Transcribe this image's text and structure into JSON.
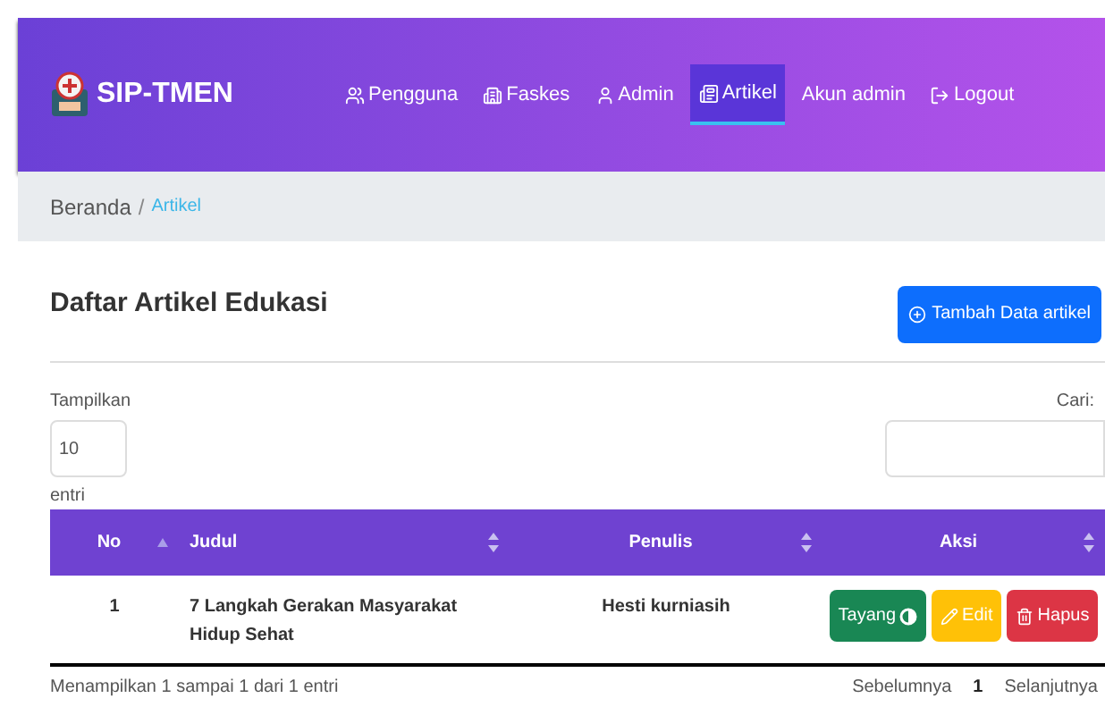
{
  "brand": {
    "name": "SIP-TMEN"
  },
  "nav": [
    {
      "label": "Pengguna",
      "selected": false
    },
    {
      "label": "Faskes",
      "selected": false
    },
    {
      "label": "Admin",
      "selected": false
    },
    {
      "label": "Artikel",
      "selected": true
    },
    {
      "label": "Akun admin",
      "selected": false
    },
    {
      "label": "Logout",
      "selected": false
    }
  ],
  "breadcrumb": {
    "separator": "/",
    "items": [
      {
        "label": "Beranda",
        "selected": false
      },
      {
        "label": "Artikel",
        "selected": true
      }
    ]
  },
  "page_title": "Daftar Artikel Edukasi",
  "add_button": "Tambah Data artikel",
  "length": {
    "label": "Tampilkan",
    "value": "10",
    "suffix": "entri"
  },
  "search": {
    "label": "Cari:"
  },
  "table": {
    "columns": [
      {
        "label": "No",
        "sorted": true
      },
      {
        "label": "Judul",
        "sorted": false
      },
      {
        "label": "Penulis",
        "sorted": false
      },
      {
        "label": "Aksi",
        "sorted": false
      }
    ],
    "rows": [
      {
        "no": "1",
        "judul": "7 Langkah Gerakan Masyarakat Hidup Sehat",
        "penulis": "Hesti kurniasih",
        "actions": [
          {
            "label": "Tayang",
            "kind": "publish"
          },
          {
            "label": "Edit",
            "kind": "edit"
          },
          {
            "label": "Hapus",
            "kind": "delete"
          }
        ]
      }
    ]
  },
  "info": "Menampilkan 1 sampai 1 dari 1 entri",
  "pagination": [
    {
      "label": "Sebelumnya",
      "selected": false
    },
    {
      "label": "1",
      "selected": true
    },
    {
      "label": "Selanjutnya",
      "selected": false
    }
  ]
}
